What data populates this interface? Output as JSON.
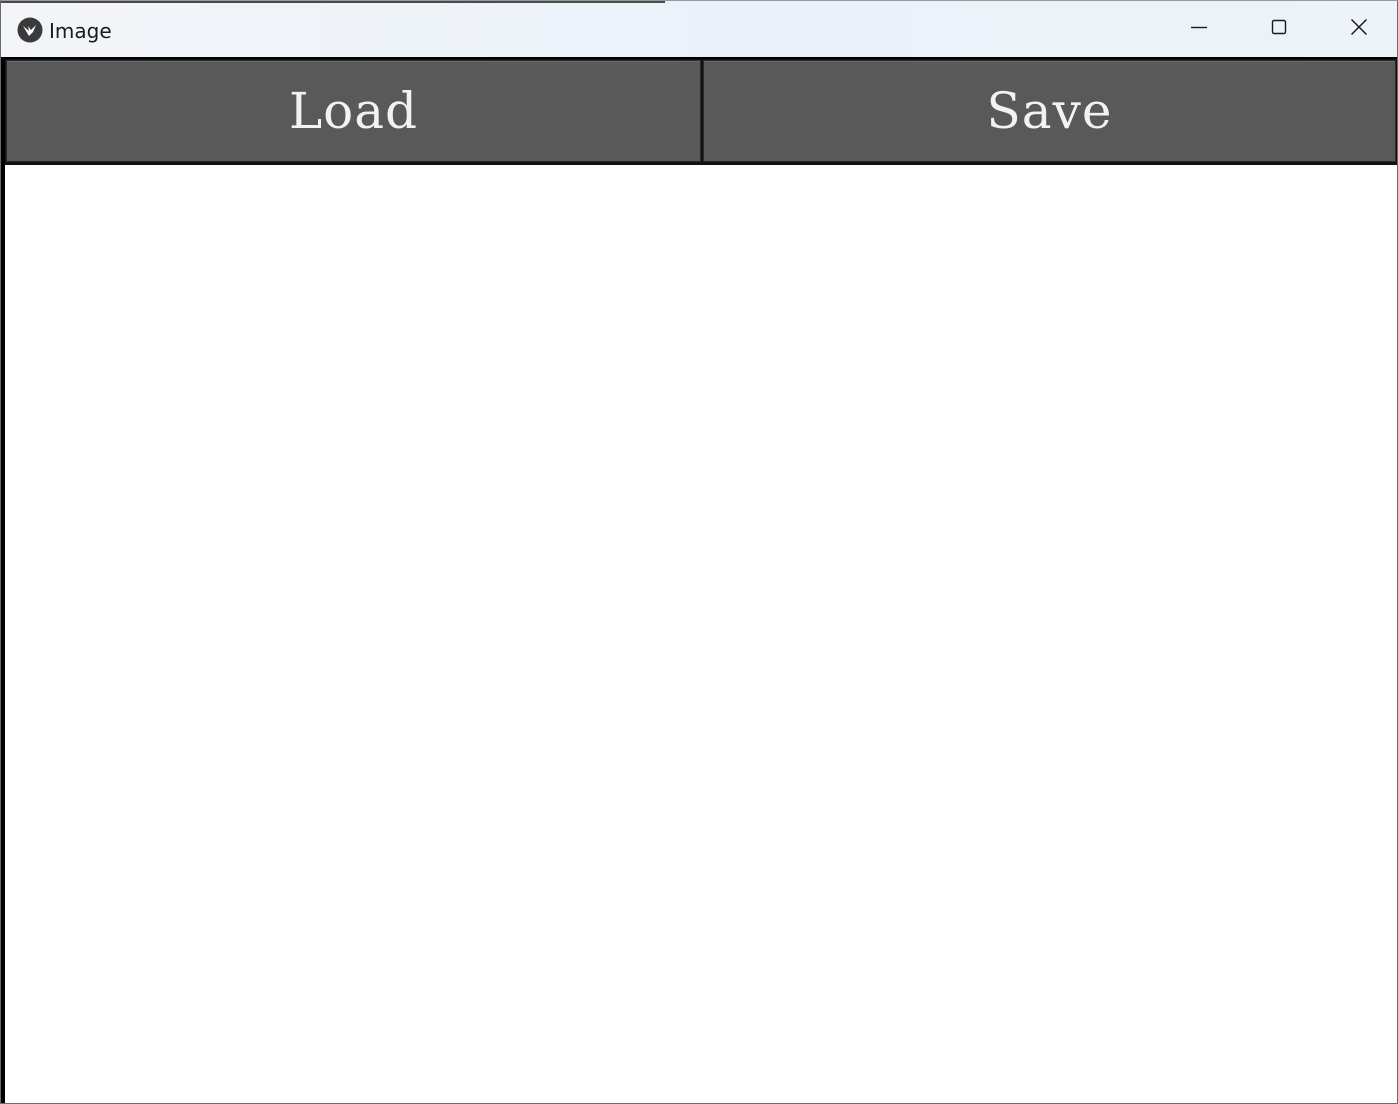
{
  "window": {
    "title": "Image",
    "icon": "kivy-app-icon",
    "controls": {
      "minimize": "minimize-icon",
      "maximize": "maximize-icon",
      "close": "close-icon"
    }
  },
  "toolbar": {
    "load_label": "Load",
    "save_label": "Save"
  },
  "colors": {
    "button_bg": "#595959",
    "button_text": "#f2f2f2",
    "canvas_bg": "#ffffff",
    "titlebar_bg": "#eef3f8"
  }
}
